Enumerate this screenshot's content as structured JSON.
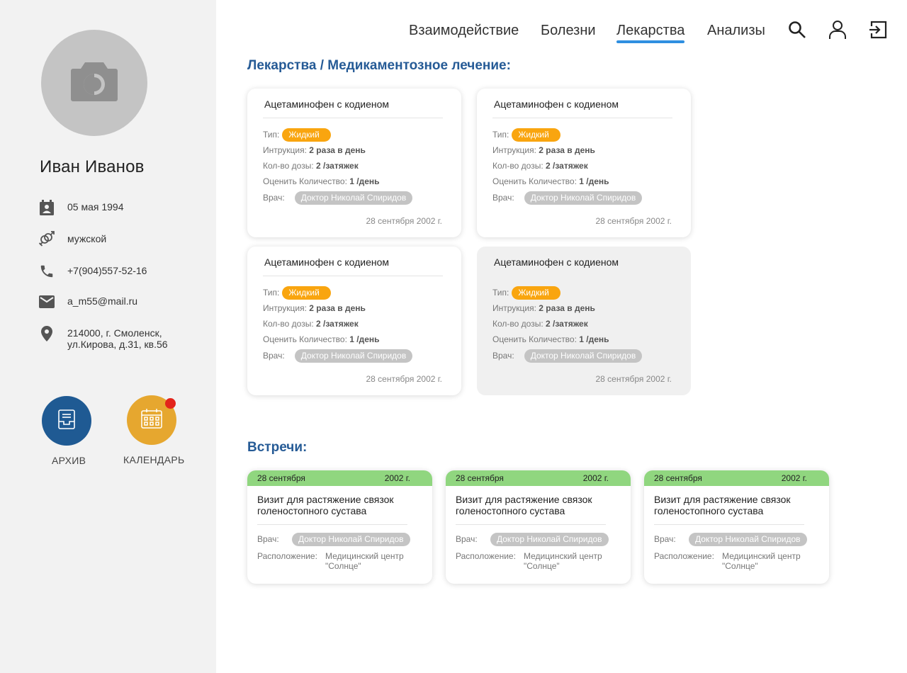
{
  "profile": {
    "name": "Иван Иванов",
    "birthdate": "05 мая 1994",
    "gender": "мужской",
    "phone": "+7(904)557-52-16",
    "email": "a_m55@mail.ru",
    "address_line1": "214000, г. Смоленск,",
    "address_line2": "ул.Кирова, д.31, кв.56"
  },
  "actions": {
    "archive_label": "АРХИВ",
    "calendar_label": "КАЛЕНДАРЬ",
    "archive_color": "#1f5a93",
    "calendar_color": "#e6a72f"
  },
  "nav": {
    "items": [
      "Взаимодействие",
      "Болезни",
      "Лекарства",
      "Анализы"
    ],
    "active": "Лекарства",
    "icons": [
      "search-icon",
      "user-icon",
      "logout-icon"
    ]
  },
  "medications": {
    "title": "Лекарства / Медикаментозное лечение:",
    "type_label": "Тип:",
    "instruction_label": "Интрукция:",
    "dose_label": "Кол-во дозы:",
    "rate_label": "Оценить Количество:",
    "doctor_label": "Врач:",
    "cards": [
      {
        "name": "Ацетаминофен с кодиеном",
        "type": "Жидкий",
        "instruction": "2 раза в  день",
        "dose": "2 /затяжек",
        "amount": "1 /день",
        "doctor": "Доктор Николай Спиридов",
        "date": "28 сентября 2002 г."
      },
      {
        "name": "Ацетаминофен с кодиеном",
        "type": "Жидкий",
        "instruction": "2 раза в  день",
        "dose": "2 /затяжек",
        "amount": "1 /день",
        "doctor": "Доктор Николай Спиридов",
        "date": "28 сентября 2002 г."
      },
      {
        "name": "Ацетаминофен с кодиеном",
        "type": "Жидкий",
        "instruction": "2 раза в  день",
        "dose": "2 /затяжек",
        "amount": "1 /день",
        "doctor": "Доктор Николай Спиридов",
        "date": "28 сентября 2002 г."
      },
      {
        "name": "Ацетаминофен с кодиеном",
        "type": "Жидкий",
        "instruction": "2 раза в  день",
        "dose": "2 /затяжек",
        "amount": "1 /день",
        "doctor": "Доктор Николай Спиридов",
        "date": "28 сентября 2002 г."
      }
    ]
  },
  "meetings": {
    "title": "Встречи:",
    "doctor_label": "Врач:",
    "location_label": "Расположение:",
    "cards": [
      {
        "date": "28 сентября",
        "year": "2002 г.",
        "title": "Визит для растяжение связок голеностопного сустава",
        "doctor": "Доктор Николай Спиридов",
        "location": "Медицинский центр \"Солнце\""
      },
      {
        "date": "28 сентября",
        "year": "2002 г.",
        "title": "Визит для растяжение связок голеностопного сустава",
        "doctor": "Доктор Николай Спиридов",
        "location": "Медицинский центр \"Солнце\""
      },
      {
        "date": "28 сентября",
        "year": "2002 г.",
        "title": "Визит для растяжение связок голеностопного сустава",
        "doctor": "Доктор Николай Спиридов",
        "location": "Медицинский центр \"Солнце\""
      }
    ]
  },
  "colors": {
    "accent": "#2f8fe0",
    "section_title": "#265b96",
    "type_tag": "#f9a50f",
    "doctor_tag": "#c4c4c4",
    "meeting_header": "#90d67f",
    "notification": "#e3241b"
  }
}
